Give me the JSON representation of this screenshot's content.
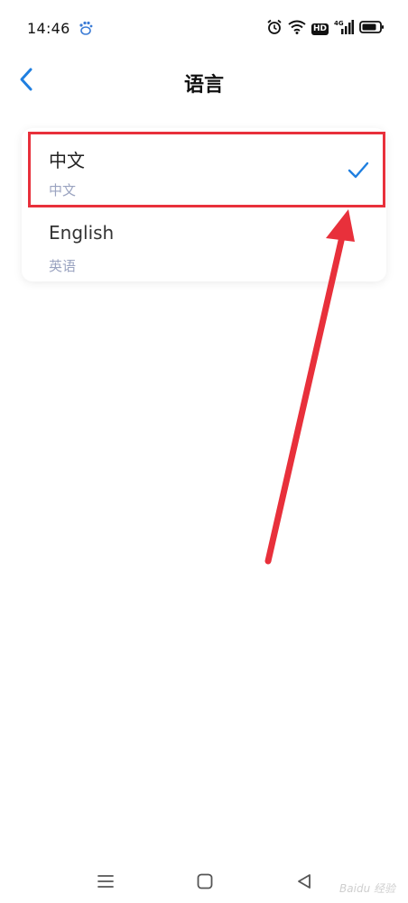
{
  "status_bar": {
    "time": "14:46",
    "app_icon": "paw-icon",
    "icons": [
      "alarm-icon",
      "wifi-icon",
      "hd-icon",
      "signal-4g-icon",
      "battery-icon"
    ],
    "hd_label": "HD",
    "network_label": "4G"
  },
  "header": {
    "back_icon": "chevron-left-icon",
    "title": "语言"
  },
  "languages": [
    {
      "name": "中文",
      "native": "中文",
      "selected": true
    },
    {
      "name": "English",
      "native": "英语",
      "selected": false
    }
  ],
  "annotation": {
    "highlight_color": "#e8303b",
    "arrow_color": "#e8303b"
  },
  "nav_bar": {
    "icons": [
      "menu-icon",
      "home-icon",
      "back-triangle-icon"
    ]
  },
  "watermark": "Baidu 经验",
  "colors": {
    "accent": "#1f7fe0",
    "subtitle": "#9aa3c0",
    "annotation_red": "#e8303b"
  }
}
